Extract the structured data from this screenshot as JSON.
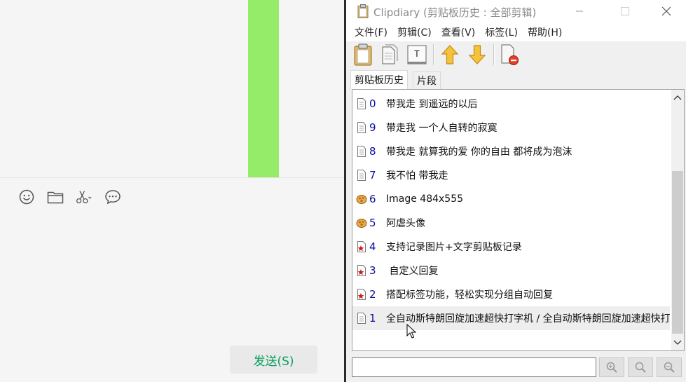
{
  "chat": {
    "tool_icons": [
      "smiley-icon",
      "folder-icon",
      "scissors-icon",
      "chat-bubble-icon"
    ],
    "send_label": "发送(S)",
    "accent_color": "#95ec69",
    "send_color": "#07a05e"
  },
  "clipdiary": {
    "title": "Clipdiary (剪贴板历史 : 全部剪辑)",
    "menu": [
      "文件(F)",
      "剪辑(C)",
      "查看(V)",
      "标签(L)",
      "帮助(H)"
    ],
    "toolbar": [
      "paste-icon",
      "copy-icon",
      "paste-text-icon",
      "move-up-icon",
      "move-down-icon",
      "delete-icon"
    ],
    "tabs": [
      "剪贴板历史",
      "片段"
    ],
    "active_tab": "剪贴板历史",
    "items": [
      {
        "num": "0",
        "type": "text",
        "text": "带我走 到遥远的以后"
      },
      {
        "num": "9",
        "type": "text",
        "text": "带走我 一个人自转的寂寞"
      },
      {
        "num": "8",
        "type": "text",
        "text": "带我走 就算我的爱 你的自由 都将成为泡沫"
      },
      {
        "num": "7",
        "type": "text",
        "text": "我不怕 带我走"
      },
      {
        "num": "6",
        "type": "image",
        "text": "Image 484x555"
      },
      {
        "num": "5",
        "type": "image",
        "text": "阿虐头像"
      },
      {
        "num": "4",
        "type": "starred",
        "text": "支持记录图片+文字剪贴板记录"
      },
      {
        "num": "3",
        "type": "starred",
        "text": " 自定义回复"
      },
      {
        "num": "2",
        "type": "starred",
        "text": "搭配标签功能，轻松实现分组自动回复"
      },
      {
        "num": "1",
        "type": "text",
        "text": "全自动斯特朗回旋加速超快打字机 / 全自动斯特朗回旋加速超快打字机"
      }
    ],
    "selected_num": "1",
    "search": {
      "value": "",
      "placeholder": ""
    },
    "search_buttons": [
      "zoom-in-search-icon",
      "search-icon",
      "zoom-out-search-icon"
    ]
  }
}
